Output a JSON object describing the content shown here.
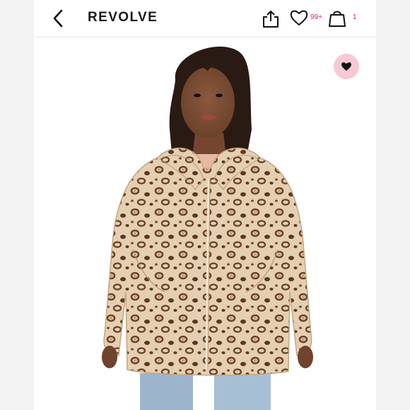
{
  "header": {
    "brand": "REVOLVE",
    "wishlist_count": "99+",
    "bag_count": "1"
  },
  "icons": {
    "back": "chevron-left-icon",
    "share": "share-icon",
    "wishlist": "heart-outline-icon",
    "bag": "shopping-bag-icon",
    "favorite": "heart-filled-icon"
  },
  "colors": {
    "brand_text": "#1a1a1a",
    "badge_pink": "#d41f86",
    "favorite_bg": "#f7c9d4",
    "coat_base": "#e3cdb2",
    "leopard_spot": "#6b4326"
  }
}
